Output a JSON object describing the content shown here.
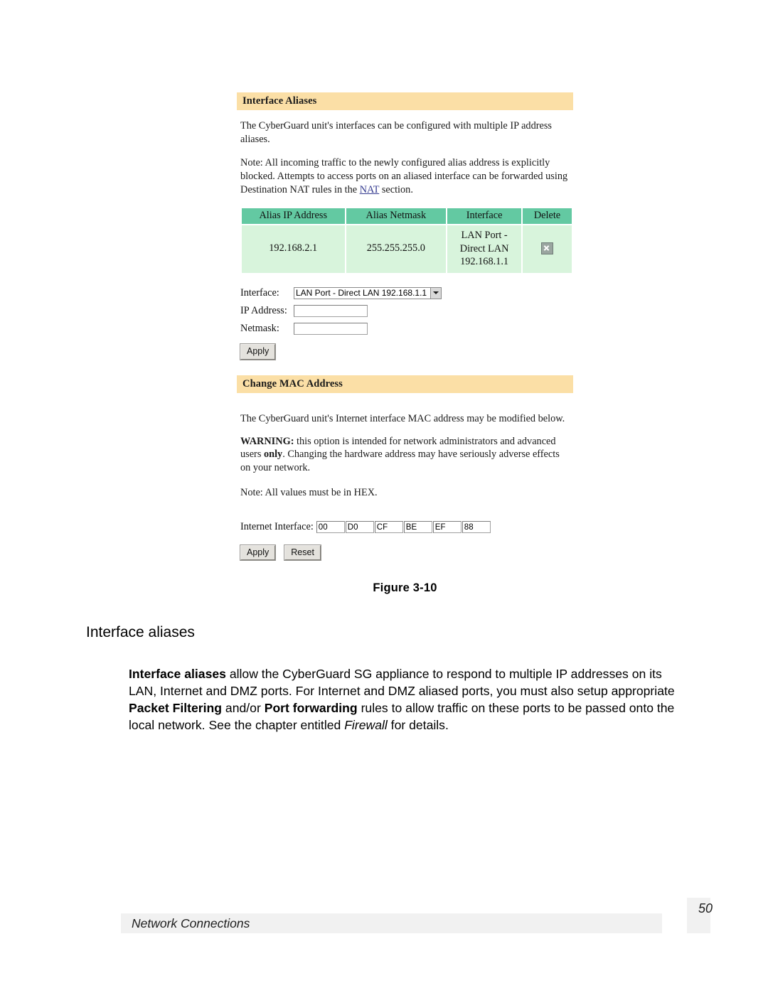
{
  "figure": {
    "panels": [
      {
        "title": "Interface Aliases",
        "paragraphs": [
          "The CyberGuard unit's interfaces can be configured with multiple IP address aliases.",
          "Note: All incoming traffic to the newly configured alias address is explicitly blocked. Attempts to access ports on an aliased interface can be forwarded using Destination NAT rules in the "
        ],
        "note_link_text": "NAT",
        "note_tail": " section."
      }
    ],
    "alias_table": {
      "columns": [
        "Alias IP Address",
        "Alias Netmask",
        "Interface",
        "Delete"
      ],
      "rows": [
        {
          "alias_ip": "192.168.2.1",
          "alias_netmask": "255.255.255.0",
          "interface_line1": "LAN Port -",
          "interface_line2": "Direct LAN",
          "interface_line3": "192.168.1.1",
          "delete_icon": "delete-x-icon"
        }
      ]
    },
    "alias_form": {
      "interface_label": "Interface:",
      "interface_selected": "LAN Port - Direct LAN 192.168.1.1",
      "ip_label": "IP Address:",
      "ip_value": "",
      "netmask_label": "Netmask:",
      "netmask_value": "",
      "apply_label": "Apply"
    },
    "mac_panel": {
      "title": "Change MAC Address",
      "intro": "The CyberGuard unit's Internet interface MAC address may be modified below.",
      "warning_label": "WARNING:",
      "warning_part1": " this option is intended for network administrators and advanced users ",
      "warning_emph": "only",
      "warning_part2": ". Changing the hardware address may have seriously adverse effects on your network.",
      "note": "Note: All values must be in HEX.",
      "mac_label": "Internet Interface:",
      "mac_octets": [
        "00",
        "D0",
        "CF",
        "BE",
        "EF",
        "88"
      ],
      "apply_label": "Apply",
      "reset_label": "Reset"
    },
    "caption": "Figure 3-10"
  },
  "document": {
    "heading": "Interface aliases",
    "body": {
      "lead_bold": "Interface aliases",
      "seg1": " allow the CyberGuard SG appliance to respond to multiple IP addresses on its LAN, Internet and DMZ ports.  For Internet and DMZ aliased ports, you must also setup appropriate ",
      "bold1": "Packet Filtering",
      "seg2": " and/or ",
      "bold2": "Port forwarding",
      "seg3": " rules to allow traffic on these ports to be passed onto the local network.  See the chapter entitled ",
      "italic1": "Firewall",
      "seg4": " for details."
    }
  },
  "footer": {
    "section": "Network Connections",
    "page_number": "50"
  },
  "colors": {
    "panel_bar": "#fbdfa6",
    "table_header": "#63c9a2",
    "table_body": "#d8f4dc",
    "link": "#333a8f",
    "footer_band": "#f1f1f1"
  }
}
